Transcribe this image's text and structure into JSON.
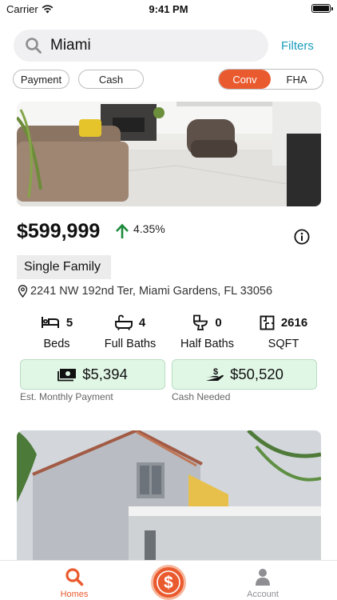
{
  "status_bar": {
    "carrier": "Carrier",
    "time": "9:41 PM"
  },
  "search": {
    "value": "Miami",
    "filters_label": "Filters"
  },
  "filters": {
    "payment_label": "Payment",
    "cash_label": "Cash",
    "loan_types": [
      "Conv",
      "FHA"
    ],
    "selected_loan_type": "Conv"
  },
  "listing": {
    "price": "$599,999",
    "change": "4.35%",
    "property_type": "Single Family",
    "address": "2241 NW 192nd Ter, Miami Gardens, FL 33056",
    "stats": [
      {
        "value": "5",
        "label": "Beds",
        "icon": "bed-icon"
      },
      {
        "value": "4",
        "label": "Full Baths",
        "icon": "bathtub-icon"
      },
      {
        "value": "0",
        "label": "Half Baths",
        "icon": "toilet-icon"
      },
      {
        "value": "2616",
        "label": "SQFT",
        "icon": "floorplan-icon"
      }
    ],
    "monthly_payment": "$5,394",
    "monthly_payment_caption": "Est. Monthly Payment",
    "cash_needed": "$50,520",
    "cash_needed_caption": "Cash Needed"
  },
  "tab_bar": {
    "items": [
      {
        "label": "Homes",
        "icon": "search-icon",
        "active": true
      },
      {
        "label": "",
        "icon": "dollar-icon",
        "active": false
      },
      {
        "label": "Account",
        "icon": "person-icon",
        "active": false
      }
    ]
  },
  "colors": {
    "accent": "#ea5a2f",
    "link": "#1a9dbd",
    "trend_up": "#1d8a3c",
    "money_box": "#e1f7e6"
  }
}
